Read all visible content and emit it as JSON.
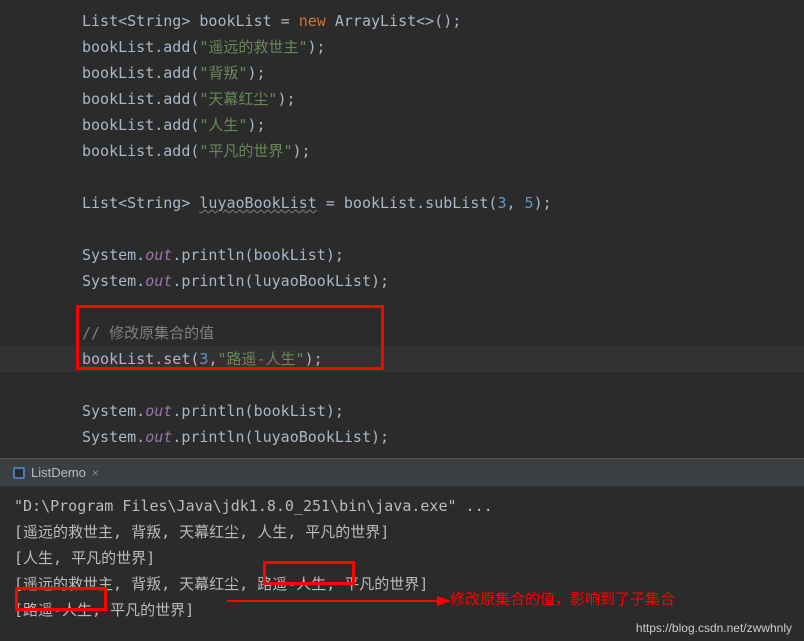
{
  "code": {
    "l1_a": "List<String> bookList = ",
    "l1_new": "new",
    "l1_b": " ArrayList<>();",
    "l2_a": "bookList.add(",
    "l2_s": "\"遥远的救世主\"",
    "l2_b": ");",
    "l3_a": "bookList.add(",
    "l3_s": "\"背叛\"",
    "l3_b": ");",
    "l4_a": "bookList.add(",
    "l4_s": "\"天幕红尘\"",
    "l4_b": ");",
    "l5_a": "bookList.add(",
    "l5_s": "\"人生\"",
    "l5_b": ");",
    "l6_a": "bookList.add(",
    "l6_s": "\"平凡的世界\"",
    "l6_b": ");",
    "l8_a": "List<String> ",
    "l8_var": "luyaoBookList",
    "l8_b": " = bookList.subList(",
    "l8_n1": "3",
    "l8_c1": ", ",
    "l8_n2": "5",
    "l8_c2": ");",
    "l10_a": "System.",
    "l10_out": "out",
    "l10_b": ".println(bookList);",
    "l11_a": "System.",
    "l11_out": "out",
    "l11_b": ".println(luyaoBookList);",
    "l13_comment": "// 修改原集合的值",
    "l14_a": "bookList.set(",
    "l14_n": "3",
    "l14_c": ",",
    "l14_s": "\"路遥-人生\"",
    "l14_b": ");",
    "l16_a": "System.",
    "l16_out": "out",
    "l16_b": ".println(bookList);",
    "l17_a": "System.",
    "l17_out": "out",
    "l17_b": ".println(luyaoBookList);"
  },
  "console": {
    "tab_name": "ListDemo",
    "line1": "\"D:\\Program Files\\Java\\jdk1.8.0_251\\bin\\java.exe\" ...",
    "line2": "[遥远的救世主, 背叛, 天幕红尘, 人生, 平凡的世界]",
    "line3": "[人生, 平凡的世界]",
    "line4": "[遥远的救世主, 背叛, 天幕红尘, 路遥-人生, 平凡的世界]",
    "line5": "[路遥-人生, 平凡的世界]"
  },
  "annotation": "修改原集合的值，影响到了子集合",
  "watermark": "https://blog.csdn.net/zwwhnly"
}
